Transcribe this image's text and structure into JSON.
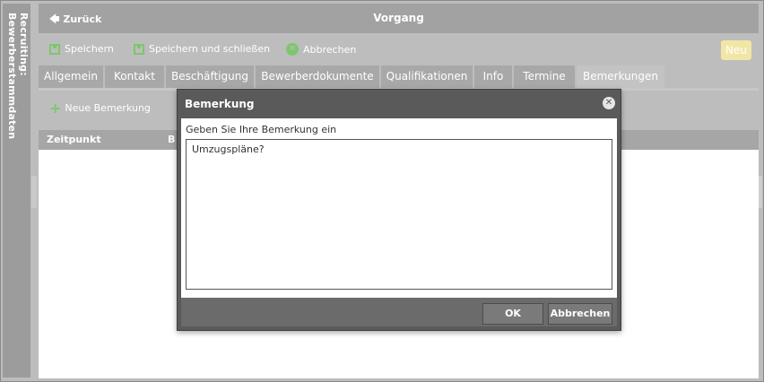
{
  "side": {
    "title": "Recruiting: Bewerberstammdaten"
  },
  "header": {
    "back_label": "Zurück",
    "title": "Vorgang"
  },
  "toolbar": {
    "save_label": "Speichern",
    "save_close_label": "Speichern und schließen",
    "cancel_label": "Abbrechen",
    "badge": "Neu"
  },
  "tabs": [
    {
      "label": "Allgemein"
    },
    {
      "label": "Kontakt"
    },
    {
      "label": "Beschäftigung"
    },
    {
      "label": "Bewerberdokumente"
    },
    {
      "label": "Qualifikationen"
    },
    {
      "label": "Info"
    },
    {
      "label": "Termine"
    },
    {
      "label": "Bemerkungen"
    }
  ],
  "subbar": {
    "add_label": "Neue Bemerkung"
  },
  "table": {
    "columns": [
      "Zeitpunkt",
      "B"
    ]
  },
  "dialog": {
    "title": "Bemerkung",
    "prompt": "Geben Sie Ihre Bemerkung ein",
    "value": "Umzugspläne?",
    "ok_label": "OK",
    "cancel_label": "Abbrechen"
  },
  "colors": {
    "accent_green": "#7dc66b",
    "badge_yellow": "#f2e6a6"
  },
  "icons": [
    "back-arrow-icon",
    "save-icon",
    "save-close-icon",
    "cancel-icon",
    "plus-icon",
    "close-icon"
  ]
}
